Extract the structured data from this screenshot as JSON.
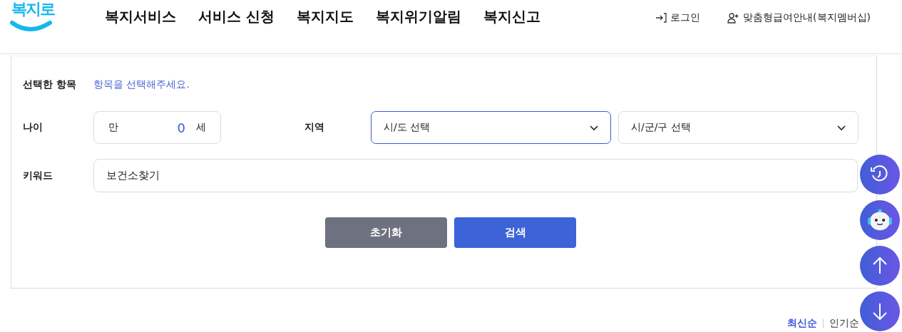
{
  "header": {
    "logo": "복지로",
    "nav": [
      "복지서비스",
      "서비스 신청",
      "복지지도",
      "복지위기알림",
      "복지신고"
    ],
    "utility": [
      {
        "label": "로그인",
        "kind": "login"
      },
      {
        "label": "맞춤형급여안내(복지멤버십)",
        "kind": "member"
      }
    ]
  },
  "search_panel": {
    "selected_items": {
      "label": "선택한 항목",
      "hint": "항목을 선택해주세요."
    },
    "age": {
      "label": "나이",
      "prefix": "만",
      "value": "0",
      "suffix": "세"
    },
    "region": {
      "label": "지역",
      "selects": [
        {
          "value": "시/도 선택",
          "focused": true
        },
        {
          "value": "시/군/구 선택",
          "focused": false
        }
      ]
    },
    "keyword": {
      "label": "키워드",
      "value": "보건소찾기"
    },
    "buttons": [
      {
        "label": "초기화",
        "kind": "reset"
      },
      {
        "label": "검색",
        "kind": "search"
      }
    ]
  },
  "sort": [
    {
      "label": "최신순",
      "selected": true
    },
    {
      "label": "인기순",
      "selected": false
    }
  ],
  "floating_buttons": [
    {
      "kind": "history"
    },
    {
      "kind": "chatbot"
    },
    {
      "kind": "top"
    },
    {
      "kind": "bottom"
    }
  ]
}
